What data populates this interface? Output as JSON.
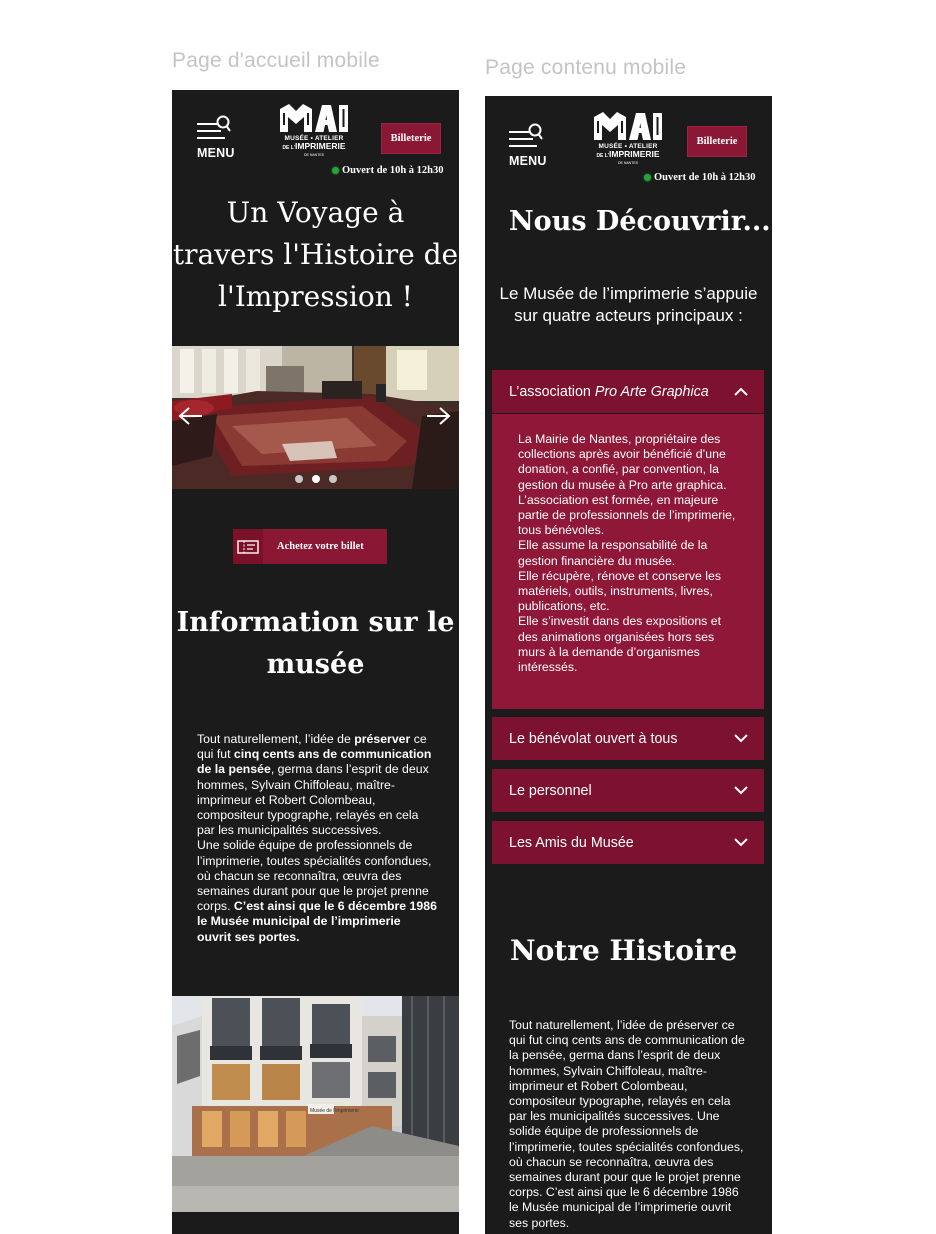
{
  "labels": {
    "frame1": "Page d'accueil mobile",
    "frame2": "Page contenu mobile"
  },
  "header": {
    "menu_label": "MENU",
    "logo_letters": "MAI",
    "logo_line1": "MUSÉE • ATELIER",
    "logo_line2_prefix": "DE L'",
    "logo_line2": "IMPRIMERIE",
    "logo_line3": "DE NANTES",
    "billetterie_label": "Billeterie",
    "open_status": "Ouvert de 10h à 12h30"
  },
  "home": {
    "hero_title": "Un Voyage à travers l'Histoire de l'Impression !",
    "carousel": {
      "slides": 3,
      "active_index": 1
    },
    "buy_button_label": "Achetez votre billet",
    "info_title": "Information sur le musée",
    "info_paragraph": {
      "t1": "Tout naturellement, l’idée de ",
      "b1": "préserver",
      "t2": " ce qui fut ",
      "b2": "cinq cents ans de communication de la pensée",
      "t3": ", germa dans l’esprit de deux hommes, Sylvain Chiffoleau, maître-imprimeur et Robert Colombeau, compositeur typographe, relayés en cela par les municipalités successives.",
      "t4": "Une solide équipe de professionnels de l’imprimerie, toutes spécialités confondues, où chacun se reconnaîtra, œuvra des semaines durant pour que le projet prenne corps. ",
      "b4": "C’est ainsi que le 6 décembre 1986 le Musée municipal de l’imprimerie ouvrit ses portes."
    },
    "building_sign": "Musée de l'imprimerie"
  },
  "content": {
    "title": "Nous Découvrir...",
    "intro": "Le Musée de l’imprimerie s’appuie sur quatre acteurs principaux :",
    "accordion": [
      {
        "label": "L’association ",
        "label_italic": "Pro Arte Graphica",
        "expanded": true
      },
      {
        "label": "Le bénévolat ouvert à tous",
        "expanded": false
      },
      {
        "label": "Le personnel",
        "expanded": false
      },
      {
        "label": "Les Amis du Musée",
        "expanded": false
      }
    ],
    "accordion_body": [
      "La Mairie de Nantes, propriétaire des collections après avoir bénéficié d’une donation, a confié, par convention, la gestion du musée à Pro arte graphica.",
      "L’association est formée, en majeure partie de professionnels de l’imprimerie, tous bénévoles.",
      "Elle assume la responsabilité de la gestion financière du musée.",
      "Elle récupère, rénove et conserve les matériels, outils, instruments, livres, publications, etc.",
      "Elle s’investit dans des expositions et des animations organisées hors ses murs à la demande d’organismes intéressés."
    ],
    "history_title": "Notre Histoire",
    "history_text": "Tout naturellement, l’idée de préserver ce qui fut cinq cents ans de communication de la pensée, germa dans l’esprit de deux hommes, Sylvain Chiffoleau, maître-imprimeur et Robert Colombeau, compositeur typographe, relayés en cela par les municipalités successives. Une solide équipe de professionnels de l’imprimerie, toutes spécialités confondues, où chacun se reconnaîtra, œuvra des semaines durant pour que le projet prenne corps. C’est ainsi que le 6 décembre 1986 le Musée municipal de l’imprimerie ouvrit ses portes."
  },
  "colors": {
    "background": "#1b1b1b",
    "accent": "#8a1733",
    "accordion_header": "#7c1230",
    "accordion_body": "#8f1838",
    "status_green": "#23a438",
    "frame_label": "#c4c4c4"
  },
  "icons": [
    "menu-search-icon",
    "arrow-left-icon",
    "arrow-right-icon",
    "ticket-icon",
    "chevron-up-icon",
    "chevron-down-icon"
  ]
}
